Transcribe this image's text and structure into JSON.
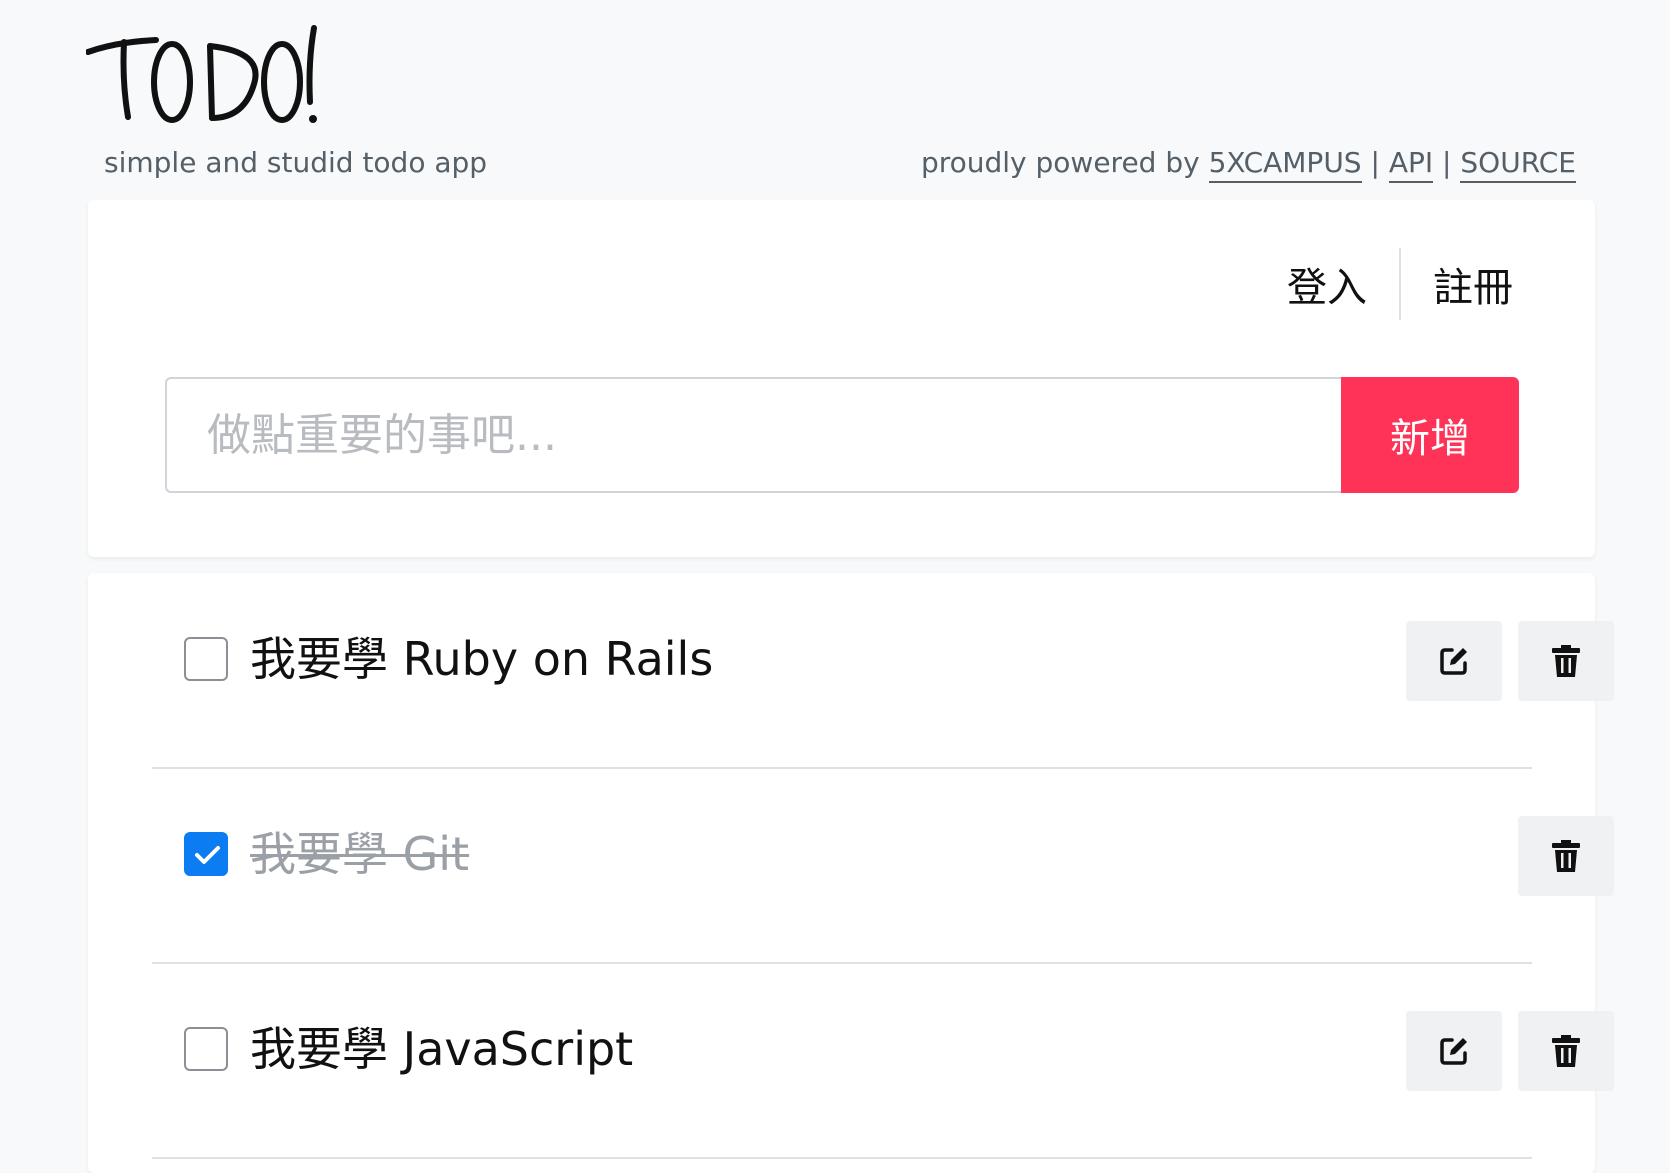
{
  "header": {
    "logo_text": "TODO!",
    "tagline": "simple and studid todo app",
    "powered_prefix": "proudly powered by",
    "links": [
      {
        "label": "5XCAMPUS"
      },
      {
        "label": "API"
      },
      {
        "label": "SOURCE"
      }
    ],
    "separator": "|"
  },
  "auth": {
    "login_label": "登入",
    "register_label": "註冊"
  },
  "add_form": {
    "placeholder": "做點重要的事吧...",
    "value": "",
    "add_button_label": "新增"
  },
  "todos": [
    {
      "text": "我要學 Ruby on Rails",
      "completed": false
    },
    {
      "text": "我要學 Git",
      "completed": true
    },
    {
      "text": "我要學 JavaScript",
      "completed": false
    }
  ],
  "icons": {
    "edit": "pencil-square-icon",
    "delete": "trash-icon",
    "check": "checkmark-icon"
  },
  "colors": {
    "accent": "#ff3358",
    "checkbox_checked": "#0b7cf2",
    "background": "#f8f9fa"
  }
}
